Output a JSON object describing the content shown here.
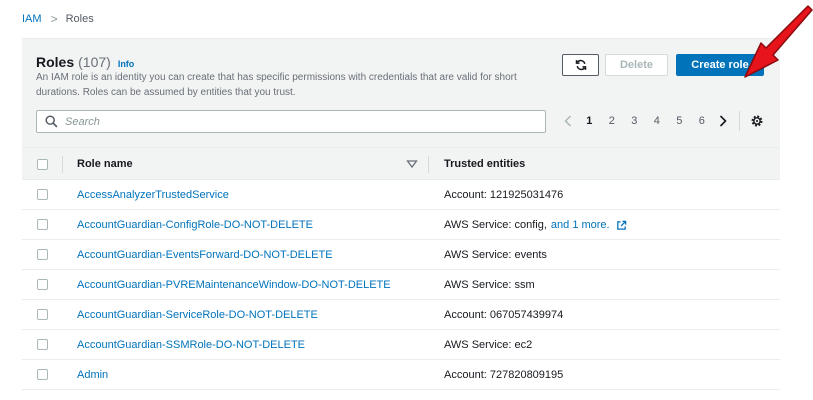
{
  "breadcrumb": {
    "parent": "IAM",
    "separator": ">",
    "current": "Roles"
  },
  "header": {
    "title": "Roles",
    "count": "(107)",
    "info": "Info",
    "description": "An IAM role is an identity you can create that has specific permissions with credentials that are valid for short durations. Roles can be assumed by entities that you trust."
  },
  "toolbar": {
    "refresh_icon": "refresh-icon",
    "delete_label": "Delete",
    "create_label": "Create role"
  },
  "search": {
    "placeholder": "Search",
    "value": ""
  },
  "pagination": {
    "pages": [
      "1",
      "2",
      "3",
      "4",
      "5",
      "6"
    ],
    "current_page": "1",
    "prev_icon": "chevron-left-icon",
    "next_icon": "chevron-right-icon",
    "settings_icon": "gear-icon"
  },
  "table": {
    "columns": {
      "role_name": "Role name",
      "trusted_entities": "Trusted entities"
    },
    "rows": [
      {
        "role_name": "AccessAnalyzerTrustedService",
        "trusted": "Account: 121925031476",
        "more": ""
      },
      {
        "role_name": "AccountGuardian-ConfigRole-DO-NOT-DELETE",
        "trusted": "AWS Service: config,",
        "more": "and 1 more."
      },
      {
        "role_name": "AccountGuardian-EventsForward-DO-NOT-DELETE",
        "trusted": "AWS Service: events",
        "more": ""
      },
      {
        "role_name": "AccountGuardian-PVREMaintenanceWindow-DO-NOT-DELETE",
        "trusted": "AWS Service: ssm",
        "more": ""
      },
      {
        "role_name": "AccountGuardian-ServiceRole-DO-NOT-DELETE",
        "trusted": "Account: 067057439974",
        "more": ""
      },
      {
        "role_name": "AccountGuardian-SSMRole-DO-NOT-DELETE",
        "trusted": "AWS Service: ec2",
        "more": ""
      },
      {
        "role_name": "Admin",
        "trusted": "Account: 727820809195",
        "more": ""
      }
    ]
  },
  "colors": {
    "link": "#0073bb",
    "primary_button": "#0073bb",
    "header_bg": "#f2f3f3",
    "annotation_arrow": "#e8141c"
  },
  "annotation": {
    "icon": "red-arrow-icon"
  }
}
